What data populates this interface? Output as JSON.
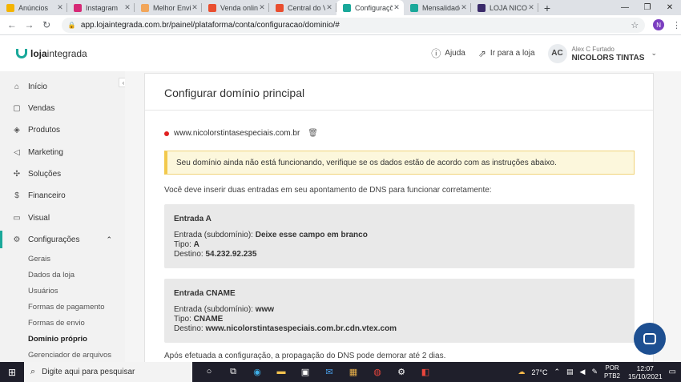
{
  "browser": {
    "tabs": [
      {
        "title": "Anúncios",
        "color": "#f4b400",
        "active": false
      },
      {
        "title": "Instagram",
        "color": "#d62976",
        "active": false
      },
      {
        "title": "Melhor Envio",
        "color": "#f2a65a",
        "active": false
      },
      {
        "title": "Venda online",
        "color": "#e94e2f",
        "active": false
      },
      {
        "title": "Central do Ve",
        "color": "#e94e2f",
        "active": false
      },
      {
        "title": "Configuraçõ",
        "color": "#1aa89a",
        "active": true
      },
      {
        "title": "Mensalidade",
        "color": "#1aa89a",
        "active": false
      },
      {
        "title": "LOJA NICOLO",
        "color": "#3a2a6a",
        "active": false
      }
    ],
    "url": "app.lojaintegrada.com.br/painel/plataforma/conta/configuracao/dominio/#",
    "profile_initial": "N"
  },
  "header": {
    "logo_bold": "loja",
    "logo_rest": "integrada",
    "help_label": "Ajuda",
    "store_link_label": "Ir para a loja",
    "avatar_initials": "AC",
    "user_name": "Alex C Furtado",
    "store_name": "NICOLORS TINTAS"
  },
  "sidebar": {
    "items": [
      {
        "label": "Início",
        "icon": "home-icon",
        "glyph": "⌂"
      },
      {
        "label": "Vendas",
        "icon": "cart-icon",
        "glyph": "▢"
      },
      {
        "label": "Produtos",
        "icon": "box-icon",
        "glyph": "◈"
      },
      {
        "label": "Marketing",
        "icon": "megaphone-icon",
        "glyph": "◁"
      },
      {
        "label": "Soluções",
        "icon": "puzzle-icon",
        "glyph": "✣"
      },
      {
        "label": "Financeiro",
        "icon": "dollar-icon",
        "glyph": "$"
      },
      {
        "label": "Visual",
        "icon": "monitor-icon",
        "glyph": "▭"
      },
      {
        "label": "Configurações",
        "icon": "settings-icon",
        "glyph": "⚙"
      }
    ],
    "sub_items": [
      "Gerais",
      "Dados da loja",
      "Usuários",
      "Formas de pagamento",
      "Formas de envio",
      "Domínio próprio",
      "Gerenciador de arquivos"
    ]
  },
  "main": {
    "title": "Configurar domínio principal",
    "domain": "www.nicolorstintasespeciais.com.br",
    "status_color": "#e02020",
    "alert": "Seu domínio ainda não está funcionando, verifique se os dados estão de acordo com as instruções abaixo.",
    "intro": "Você deve inserir duas entradas em seu apontamento de DNS para funcionar corretamente:",
    "entry_a": {
      "heading": "Entrada A",
      "sub_label": "Entrada (subdomínio):",
      "sub_value": "Deixe esse campo em branco",
      "type_label": "Tipo:",
      "type_value": "A",
      "dest_label": "Destino:",
      "dest_value": "54.232.92.235"
    },
    "entry_cname": {
      "heading": "Entrada CNAME",
      "sub_label": "Entrada (subdomínio):",
      "sub_value": "www",
      "type_label": "Tipo:",
      "type_value": "CNAME",
      "dest_label": "Destino:",
      "dest_value": "www.nicolorstintasespeciais.com.br.cdn.vtex.com"
    },
    "footer": "Após efetuada a configuração, a propagação do DNS pode demorar até 2 dias."
  },
  "taskbar": {
    "search_placeholder": "Digite aqui para pesquisar",
    "weather": "27°C",
    "lang_1": "POR",
    "lang_2": "PTB2",
    "time": "12:07",
    "date": "15/10/2021"
  }
}
